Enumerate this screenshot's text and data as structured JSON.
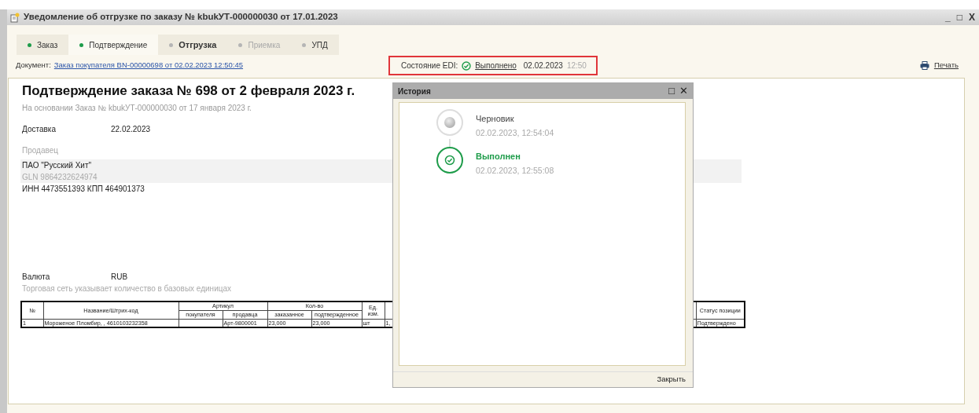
{
  "window": {
    "title": "Уведомление об отгрузке по заказу № kbukУТ-000000030 от 17.01.2023",
    "controls": [
      "_",
      "□",
      "X"
    ]
  },
  "tabs": [
    {
      "label": "Заказ",
      "done": true,
      "selected": false,
      "current": false,
      "disabled": false
    },
    {
      "label": "Подтверждение",
      "done": true,
      "selected": true,
      "current": false,
      "disabled": false
    },
    {
      "label": "Отгрузка",
      "done": false,
      "selected": false,
      "current": true,
      "disabled": false
    },
    {
      "label": "Приемка",
      "done": false,
      "selected": false,
      "current": false,
      "disabled": true
    },
    {
      "label": "УПД",
      "done": false,
      "selected": false,
      "current": false,
      "disabled": false
    }
  ],
  "document": {
    "label": "Документ:",
    "link": "Заказ покупателя BN-00000698 от 02.02.2023 12:50:45"
  },
  "edi_status": {
    "label": "Состояние EDI:",
    "status": "Выполнено",
    "date": "02.02.2023",
    "time": "12:50"
  },
  "print": {
    "label": "Печать"
  },
  "report": {
    "title": "Подтверждение заказа № 698 от 2 февраля 2023 г.",
    "basis": "На основании Заказ № kbukУТ-000000030 от 17 января 2023 г.",
    "delivery": {
      "label": "Доставка",
      "value": "22.02.2023"
    },
    "seller": {
      "label": "Продавец",
      "name": "ПАО \"Русский Хит\"",
      "gln": "GLN 9864232624974",
      "tax": "ИНН 4473551393 КПП 464901373"
    },
    "currency": {
      "label": "Валюта",
      "value": "RUB"
    },
    "note": "Торговая сеть указывает количество в базовых единицах",
    "table": {
      "header_rows": [
        [
          {
            "text": "№",
            "rowspan": 2
          },
          {
            "text": "Название/Штрих-код",
            "rowspan": 2
          },
          {
            "text": "Артикул",
            "colspan": 2
          },
          {
            "text": "Кол-во",
            "colspan": 2
          },
          {
            "text": "Ед. изм.",
            "rowspan": 2
          },
          {
            "rowspan": 2
          },
          {
            "text": "Статус позиции",
            "rowspan": 2
          }
        ],
        [
          {
            "text": "покупателя"
          },
          {
            "text": "продавца"
          },
          {
            "text": "заказанное"
          },
          {
            "text": "подтвержденное"
          }
        ]
      ],
      "rows": [
        {
          "cells": [
            "1",
            "Мороженое Пломбир, , 4610103232358",
            null,
            "Арт-9800001",
            "23,000",
            "23,000",
            "шт",
            "1,",
            "Подтверждено"
          ]
        }
      ]
    }
  },
  "history": {
    "title": "История",
    "controls": [
      "□",
      "✕"
    ],
    "events": [
      {
        "kind": "pending",
        "status": "Черновик",
        "time": "02.02.2023, 12:54:04"
      },
      {
        "kind": "done",
        "status": "Выполнен",
        "time": "02.02.2023, 12:55:08"
      }
    ],
    "close_button": "Закрыть"
  }
}
